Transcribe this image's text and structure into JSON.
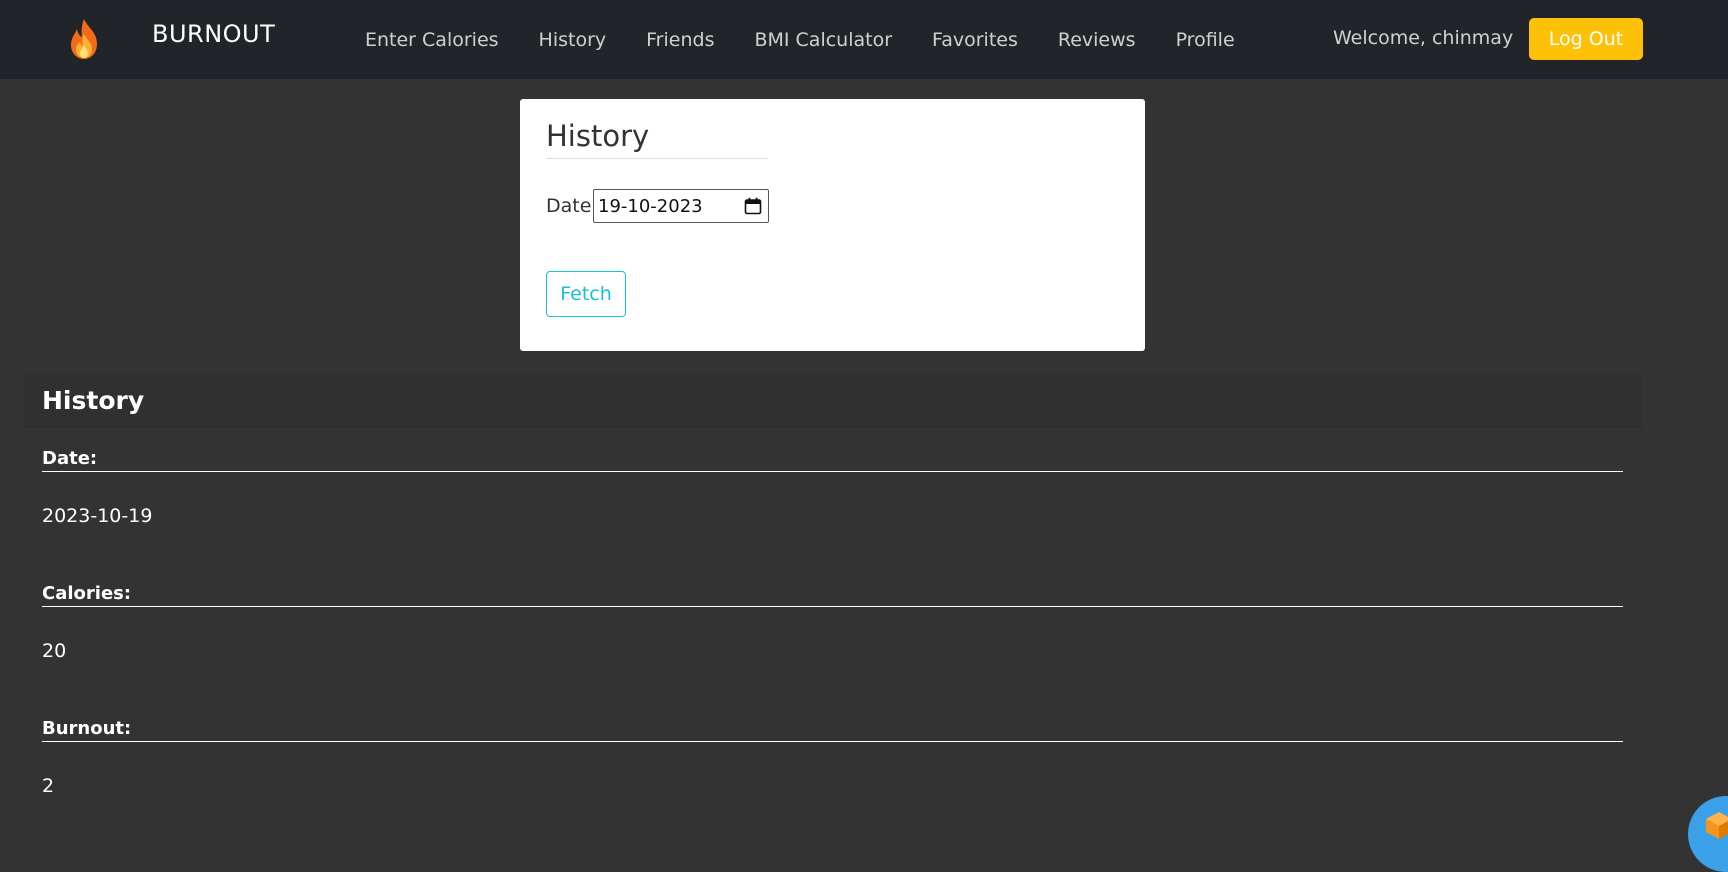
{
  "navbar": {
    "brand_icon": "flame-icon",
    "brand_name": "BURNOUT",
    "links": [
      {
        "label": "Enter Calories"
      },
      {
        "label": "History"
      },
      {
        "label": "Friends"
      },
      {
        "label": "BMI Calculator"
      },
      {
        "label": "Favorites"
      },
      {
        "label": "Reviews"
      },
      {
        "label": "Profile"
      }
    ],
    "welcome_text": "Welcome, chinmay",
    "logout_label": "Log Out"
  },
  "history_form": {
    "title": "History",
    "date_label": "Date",
    "date_value": "19-10-2023",
    "fetch_label": "Fetch"
  },
  "history_results": {
    "title": "History",
    "fields": [
      {
        "label": "Date:",
        "value": "2023-10-19"
      },
      {
        "label": "Calories:",
        "value": "20"
      },
      {
        "label": "Burnout:",
        "value": "2"
      }
    ]
  },
  "colors": {
    "navbar_bg": "#212529",
    "page_bg": "#333333",
    "logout_bg": "#ffc107",
    "fetch_accent": "#17c0d6"
  }
}
